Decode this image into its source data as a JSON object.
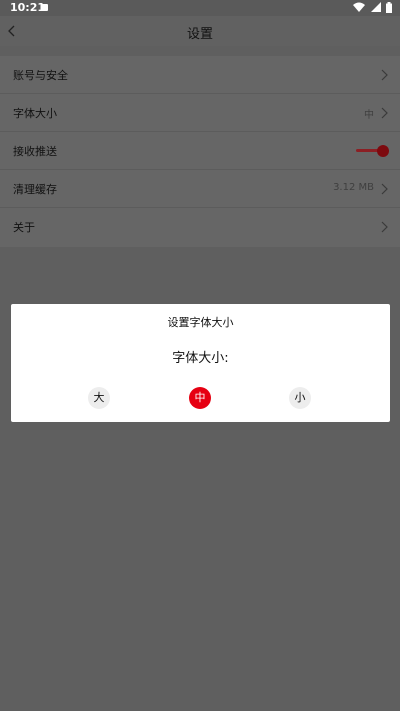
{
  "status_bar": {
    "time": "10:21",
    "app_icon": "notification-icon",
    "icons": [
      "wifi-icon",
      "signal-icon",
      "battery-icon"
    ]
  },
  "header": {
    "title": "设置",
    "back_icon": "back-chevron-icon"
  },
  "settings": {
    "account_security": {
      "label": "账号与安全"
    },
    "font_size": {
      "label": "字体大小",
      "value": "中"
    },
    "push_notifications": {
      "label": "接收推送",
      "enabled": true
    },
    "clear_cache": {
      "label": "清理缓存",
      "value": "3.12 MB"
    },
    "about": {
      "label": "关于"
    }
  },
  "dialog": {
    "title": "设置字体大小",
    "subtitle": "字体大小:",
    "options": [
      {
        "label": "大",
        "selected": false
      },
      {
        "label": "中",
        "selected": true
      },
      {
        "label": "小",
        "selected": false
      }
    ]
  },
  "colors": {
    "accent": "#e60012",
    "overlay": "#5f5f5f",
    "dialog_background": "#ffffff"
  }
}
